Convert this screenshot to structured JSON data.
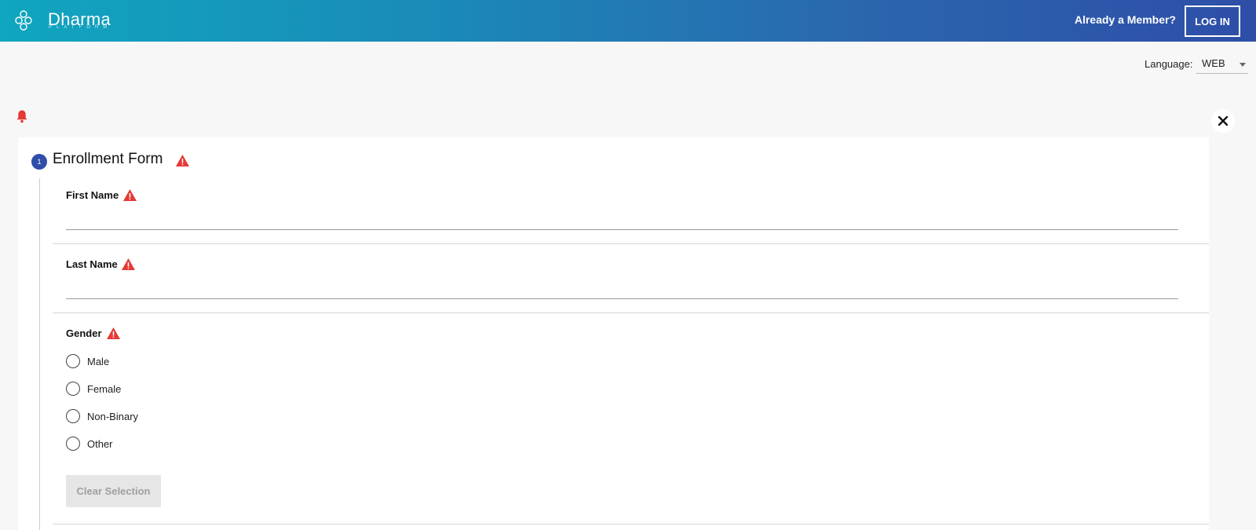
{
  "header": {
    "brand_name": "Dharma",
    "brand_subtitle": "PLATFORM",
    "member_prompt": "Already a Member?",
    "login_label": "LOG IN",
    "gradient_start": "#10a6bf",
    "gradient_end": "#2e4ea8"
  },
  "language": {
    "label": "Language:",
    "selected": "WEB"
  },
  "icons": {
    "notification": "bell-icon",
    "close": "close-icon",
    "logo": "logo-icon",
    "warning": "warning-icon"
  },
  "form": {
    "step_number": "1",
    "title": "Enrollment Form",
    "fields": [
      {
        "label": "First Name",
        "value": ""
      },
      {
        "label": "Last Name",
        "value": ""
      }
    ],
    "gender": {
      "label": "Gender",
      "options": [
        "Male",
        "Female",
        "Non-Binary",
        "Other"
      ],
      "clear_label": "Clear Selection"
    }
  },
  "colors": {
    "accent": "#2e4ea8",
    "warning": "#e53935",
    "background": "#f7f7f7"
  }
}
